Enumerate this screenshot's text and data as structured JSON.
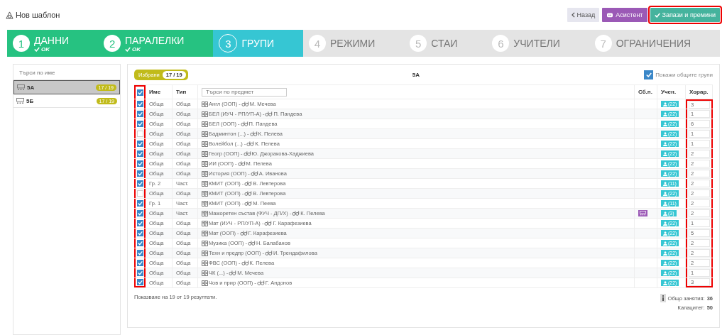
{
  "header": {
    "title": "Нов шаблон",
    "buttons": [
      {
        "kind": "back",
        "label": "Назад"
      },
      {
        "kind": "assistant",
        "label": "Асистент"
      },
      {
        "kind": "save",
        "label": "Запази и премини"
      }
    ]
  },
  "steps": [
    {
      "number": "1",
      "label": "ДАННИ",
      "completed": true,
      "selected": false,
      "sub": "OK"
    },
    {
      "number": "2",
      "label": "ПАРАЛЕЛКИ",
      "completed": true,
      "selected": false,
      "sub": "OK"
    },
    {
      "number": "3",
      "label": "ГРУПИ",
      "completed": false,
      "selected": true
    },
    {
      "number": "4",
      "label": "РЕЖИМИ",
      "completed": false,
      "selected": false
    },
    {
      "number": "5",
      "label": "СТАИ",
      "completed": false,
      "selected": false
    },
    {
      "number": "6",
      "label": "УЧИТЕЛИ",
      "completed": false,
      "selected": false
    },
    {
      "number": "7",
      "label": "ОГРАНИЧЕНИЯ",
      "completed": false,
      "selected": false
    }
  ],
  "sidebar": {
    "search": {
      "placeholder": "Търси по име"
    },
    "items": [
      {
        "name": "5А",
        "badge": "17 / 19",
        "selected": true
      },
      {
        "name": "5Б",
        "badge": "17 / 19",
        "selected": false
      }
    ]
  },
  "panel": {
    "selected_label": "Избрани",
    "selected_count": "17 / 19",
    "title": "5А",
    "show_common": {
      "label": "Покажи общите групи",
      "checked": true
    },
    "all_checked": true,
    "columns": [
      "Име",
      "Тип",
      "Сб.п.",
      "Учен.",
      "Хорар."
    ],
    "subject_search": {
      "placeholder": "Търси по предмет"
    },
    "rows": [
      {
        "checked": true,
        "name": "Обща",
        "type": "Обща",
        "subject": "Англ (ООП) -",
        "teacher": "М. Мечева",
        "combined": false,
        "students": "(22)",
        "hours": "3"
      },
      {
        "checked": true,
        "name": "Обща",
        "type": "Обща",
        "subject": "БЕЛ (ИУЧ - РП/УП-А) -",
        "teacher": "П. Пандева",
        "combined": false,
        "students": "(22)",
        "hours": "1"
      },
      {
        "checked": true,
        "name": "Обща",
        "type": "Обща",
        "subject": "БЕЛ (ООП) -",
        "teacher": "П. Пандева",
        "combined": false,
        "students": "(22)",
        "hours": "6"
      },
      {
        "checked": false,
        "name": "Обща",
        "type": "Обща",
        "subject": "Бадминтон (...) -",
        "teacher": "К. Пелева",
        "combined": false,
        "students": "(22)",
        "hours": "1"
      },
      {
        "checked": true,
        "name": "Обща",
        "type": "Обща",
        "subject": "Волейбол (...) -",
        "teacher": "К. Пелева",
        "combined": false,
        "students": "(22)",
        "hours": "1"
      },
      {
        "checked": true,
        "name": "Обща",
        "type": "Обща",
        "subject": "Геогр (ООП) -",
        "teacher": "Ю. Джоракова-Хаджиева",
        "combined": false,
        "students": "(22)",
        "hours": "2"
      },
      {
        "checked": true,
        "name": "Обща",
        "type": "Обща",
        "subject": "ИИ (ООП) -",
        "teacher": "М. Пелева",
        "combined": false,
        "students": "(22)",
        "hours": "2"
      },
      {
        "checked": true,
        "name": "Обща",
        "type": "Обща",
        "subject": "История (ООП) -",
        "teacher": "А. Иванова",
        "combined": false,
        "students": "(22)",
        "hours": "2"
      },
      {
        "checked": true,
        "name": "Гр. 2",
        "type": "Част.",
        "subject": "КМИТ (ООП) -",
        "teacher": "В. Левтерова",
        "combined": false,
        "students": "(11)",
        "hours": "2"
      },
      {
        "checked": false,
        "name": "Обща",
        "type": "Обща",
        "subject": "КМИТ (ООП) -",
        "teacher": "В. Левтерова",
        "combined": false,
        "students": "(22)",
        "hours": "2"
      },
      {
        "checked": true,
        "name": "Гр. 1",
        "type": "Част.",
        "subject": "КМИТ (ООП) -",
        "teacher": "М. Пеева",
        "combined": false,
        "students": "(11)",
        "hours": "2"
      },
      {
        "checked": true,
        "name": "Обща",
        "type": "Част.",
        "subject": "Мажоретен състав (ФУЧ - ДП/Х) -",
        "teacher": "К. Пелева",
        "combined": true,
        "students": "(3)",
        "hours": "2"
      },
      {
        "checked": true,
        "name": "Обща",
        "type": "Обща",
        "subject": "Мат (ИУЧ - РП/УП-А) -",
        "teacher": "Г. Карафезиева",
        "combined": false,
        "students": "(22)",
        "hours": "1"
      },
      {
        "checked": true,
        "name": "Обща",
        "type": "Обща",
        "subject": "Мат (ООП) -",
        "teacher": "Г. Карафезиева",
        "combined": false,
        "students": "(22)",
        "hours": "5"
      },
      {
        "checked": true,
        "name": "Обща",
        "type": "Обща",
        "subject": "Музика (ООП) -",
        "teacher": "Н. Балабанов",
        "combined": false,
        "students": "(22)",
        "hours": "2"
      },
      {
        "checked": true,
        "name": "Обща",
        "type": "Обща",
        "subject": "Техн и предпр (ООП) -",
        "teacher": "И. Трендафилова",
        "combined": false,
        "students": "(22)",
        "hours": "2"
      },
      {
        "checked": true,
        "name": "Обща",
        "type": "Обща",
        "subject": "ФВС (ООП) -",
        "teacher": "К. Пелева",
        "combined": false,
        "students": "(22)",
        "hours": "2"
      },
      {
        "checked": true,
        "name": "Обща",
        "type": "Обща",
        "subject": "ЧК (...) -",
        "teacher": "М. Мечева",
        "combined": false,
        "students": "(22)",
        "hours": "1"
      },
      {
        "checked": true,
        "name": "Обща",
        "type": "Обща",
        "subject": "Чов и прир (ООП) -",
        "teacher": "Г. Андонов",
        "combined": false,
        "students": "(22)",
        "hours": "3"
      }
    ],
    "results": "Показване на 19 от 19 резултати.",
    "totals": [
      {
        "label": "Общо занятия:",
        "value": "36",
        "info": true
      },
      {
        "label": "Капацитет:",
        "value": "50",
        "info": false
      }
    ]
  }
}
